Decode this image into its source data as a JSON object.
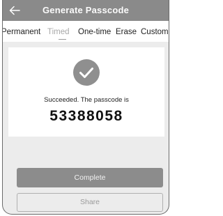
{
  "header": {
    "title": "Generate Passcode",
    "back_icon": "arrow-left-icon"
  },
  "tabs": [
    {
      "label": "Permanent",
      "active": false
    },
    {
      "label": "Timed",
      "active": true
    },
    {
      "label": "One-time",
      "active": false
    },
    {
      "label": "Erase",
      "active": false
    },
    {
      "label": "Custom",
      "active": false
    }
  ],
  "result": {
    "icon": "checkmark-circle-icon",
    "message": "Succeeded. The passcode is",
    "passcode": "53388058"
  },
  "actions": {
    "complete_label": "Complete",
    "share_label": "Share"
  },
  "colors": {
    "header_bg": "#8a8a8a",
    "primary_button": "#8c8c8c",
    "active_tab": "#a8a8a8",
    "background": "#ececec"
  }
}
